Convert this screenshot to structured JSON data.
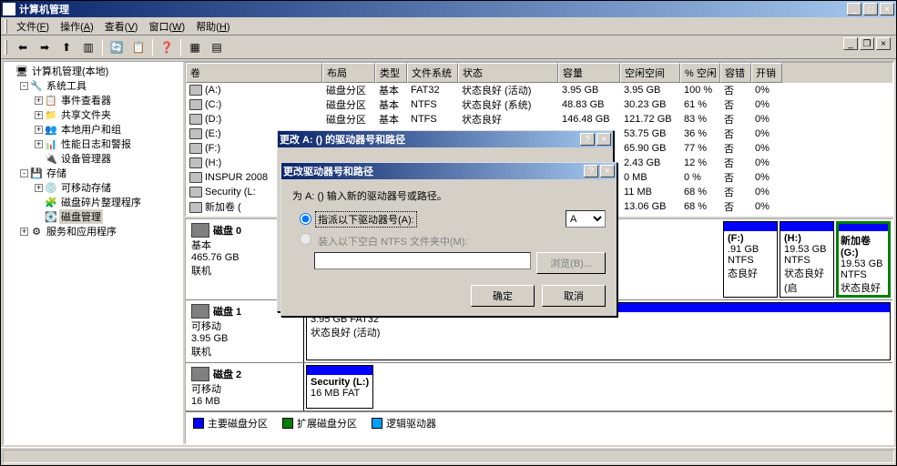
{
  "window": {
    "title": "计算机管理"
  },
  "menubar": [
    {
      "label": "文件",
      "key": "F"
    },
    {
      "label": "操作",
      "key": "A"
    },
    {
      "label": "查看",
      "key": "V"
    },
    {
      "label": "窗口",
      "key": "W"
    },
    {
      "label": "帮助",
      "key": "H"
    }
  ],
  "tree": [
    {
      "indent": 0,
      "exp": "",
      "icon": "🖥",
      "label": "计算机管理(本地)"
    },
    {
      "indent": 1,
      "exp": "-",
      "icon": "🔧",
      "label": "系统工具"
    },
    {
      "indent": 2,
      "exp": "+",
      "icon": "📋",
      "label": "事件查看器"
    },
    {
      "indent": 2,
      "exp": "+",
      "icon": "📁",
      "label": "共享文件夹"
    },
    {
      "indent": 2,
      "exp": "+",
      "icon": "👥",
      "label": "本地用户和组"
    },
    {
      "indent": 2,
      "exp": "+",
      "icon": "📊",
      "label": "性能日志和警报"
    },
    {
      "indent": 2,
      "exp": "",
      "icon": "🔌",
      "label": "设备管理器"
    },
    {
      "indent": 1,
      "exp": "-",
      "icon": "💾",
      "label": "存储"
    },
    {
      "indent": 2,
      "exp": "+",
      "icon": "💿",
      "label": "可移动存储"
    },
    {
      "indent": 2,
      "exp": "",
      "icon": "🧩",
      "label": "磁盘碎片整理程序"
    },
    {
      "indent": 2,
      "exp": "",
      "icon": "💽",
      "label": "磁盘管理",
      "selected": true
    },
    {
      "indent": 1,
      "exp": "+",
      "icon": "⚙",
      "label": "服务和应用程序"
    }
  ],
  "columns": [
    "卷",
    "布局",
    "类型",
    "文件系统",
    "状态",
    "容量",
    "空闲空间",
    "% 空闲",
    "容错",
    "开销"
  ],
  "volumes": [
    {
      "name": "(A:)",
      "layout": "磁盘分区",
      "type": "基本",
      "fs": "FAT32",
      "status": "状态良好 (活动)",
      "cap": "3.95 GB",
      "free": "3.95 GB",
      "pct": "100 %",
      "ft": "否",
      "oh": "0%"
    },
    {
      "name": "(C:)",
      "layout": "磁盘分区",
      "type": "基本",
      "fs": "NTFS",
      "status": "状态良好 (系统)",
      "cap": "48.83 GB",
      "free": "30.23 GB",
      "pct": "61 %",
      "ft": "否",
      "oh": "0%"
    },
    {
      "name": "(D:)",
      "layout": "磁盘分区",
      "type": "基本",
      "fs": "NTFS",
      "status": "状态良好",
      "cap": "146.48 GB",
      "free": "121.72 GB",
      "pct": "83 %",
      "ft": "否",
      "oh": "0%"
    },
    {
      "name": "(E:)",
      "layout": "",
      "type": "",
      "fs": "",
      "status": "",
      "cap": "",
      "free": "53.75 GB",
      "pct": "36 %",
      "ft": "否",
      "oh": "0%"
    },
    {
      "name": "(F:)",
      "layout": "",
      "type": "",
      "fs": "",
      "status": "",
      "cap": "",
      "free": "65.90 GB",
      "pct": "77 %",
      "ft": "否",
      "oh": "0%"
    },
    {
      "name": "(H:)",
      "layout": "",
      "type": "",
      "fs": "",
      "status": "",
      "cap": "",
      "free": "2.43 GB",
      "pct": "12 %",
      "ft": "否",
      "oh": "0%"
    },
    {
      "name": "INSPUR 2008",
      "layout": "",
      "type": "",
      "fs": "",
      "status": "",
      "cap": "",
      "free": "0 MB",
      "pct": "0 %",
      "ft": "否",
      "oh": "0%"
    },
    {
      "name": "Security (L:",
      "layout": "",
      "type": "",
      "fs": "",
      "status": "",
      "cap": "",
      "free": "11 MB",
      "pct": "68 %",
      "ft": "否",
      "oh": "0%"
    },
    {
      "name": "新加卷 (",
      "layout": "",
      "type": "",
      "fs": "",
      "status": "",
      "cap": "",
      "free": "13.06 GB",
      "pct": "68 %",
      "ft": "否",
      "oh": "0%"
    }
  ],
  "disks": [
    {
      "title": "磁盘 0",
      "type": "基本",
      "size": "465.76 GB",
      "state": "联机",
      "parts": [
        {
          "name": "(F:)",
          "info": ".91 GB NTFS",
          "status": "态良好",
          "color": "blue"
        },
        {
          "name": "(H:)",
          "info": "19.53 GB NTFS",
          "status": "状态良好 (启",
          "color": "blue"
        },
        {
          "name": "新加卷  (G:)",
          "info": "19.53 GB NTFS",
          "status": "状态良好",
          "color": "blue",
          "sel": true
        }
      ]
    },
    {
      "title": "磁盘 1",
      "type": "可移动",
      "size": "3.95 GB",
      "state": "联机",
      "parts": [
        {
          "name": "",
          "info": "3.95 GB FAT32",
          "status": "状态良好 (活动)",
          "color": "blue",
          "wide": true
        }
      ]
    },
    {
      "title": "磁盘 2",
      "type": "可移动",
      "size": "16 MB",
      "state": "",
      "parts": [
        {
          "name": "Security  (L:)",
          "info": "16 MB FAT",
          "status": "",
          "color": "blue"
        }
      ]
    }
  ],
  "legend": [
    {
      "color": "#0000ff",
      "label": "主要磁盘分区"
    },
    {
      "color": "#008000",
      "label": "扩展磁盘分区"
    },
    {
      "color": "#00a0ff",
      "label": "逻辑驱动器"
    }
  ],
  "dialog1": {
    "title": "更改 A: () 的驱动器号和路径",
    "ok": "确定",
    "cancel": "取消"
  },
  "dialog2": {
    "title": "更改驱动器号和路径",
    "instruction": "为 A: () 输入新的驱动器号或路径。",
    "opt1": "指派以下驱动器号(A):",
    "opt2": "装入以下空白 NTFS 文件夹中(M):",
    "selected_drive": "A",
    "browse": "浏览(B)...",
    "ok": "确定",
    "cancel": "取消"
  }
}
